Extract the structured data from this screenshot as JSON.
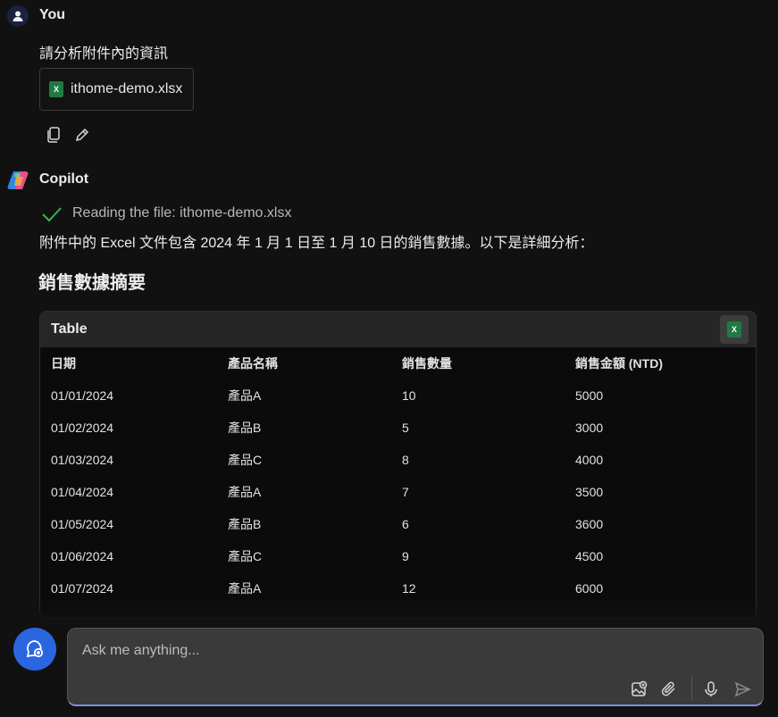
{
  "user": {
    "name": "You",
    "message": "請分析附件內的資訊",
    "attachment": "ithome-demo.xlsx"
  },
  "assistant": {
    "name": "Copilot",
    "reading_status": "Reading the file: ithome-demo.xlsx",
    "intro": "附件中的 Excel 文件包含 2024 年 1 月 1 日至 1 月 10 日的銷售數據。以下是詳細分析：",
    "section_title": "銷售數據摘要",
    "table": {
      "title": "Table",
      "headers": [
        "日期",
        "產品名稱",
        "銷售數量",
        "銷售金額 (NTD)"
      ],
      "rows": [
        [
          "01/01/2024",
          "產品A",
          "10",
          "5000"
        ],
        [
          "01/02/2024",
          "產品B",
          "5",
          "3000"
        ],
        [
          "01/03/2024",
          "產品C",
          "8",
          "4000"
        ],
        [
          "01/04/2024",
          "產品A",
          "7",
          "3500"
        ],
        [
          "01/05/2024",
          "產品B",
          "6",
          "3600"
        ],
        [
          "01/06/2024",
          "產品C",
          "9",
          "4500"
        ],
        [
          "01/07/2024",
          "產品A",
          "12",
          "6000"
        ]
      ]
    }
  },
  "composer": {
    "placeholder": "Ask me anything..."
  },
  "colors": {
    "background": "#121111",
    "accent": "#2a66e0",
    "excel_green": "#1f7a44"
  },
  "icons": [
    "user-avatar-icon",
    "excel-file-icon",
    "copy-icon",
    "edit-icon",
    "copilot-logo-icon",
    "checkmark-icon",
    "new-chat-icon",
    "add-image-icon",
    "attach-icon",
    "microphone-icon",
    "send-icon"
  ]
}
